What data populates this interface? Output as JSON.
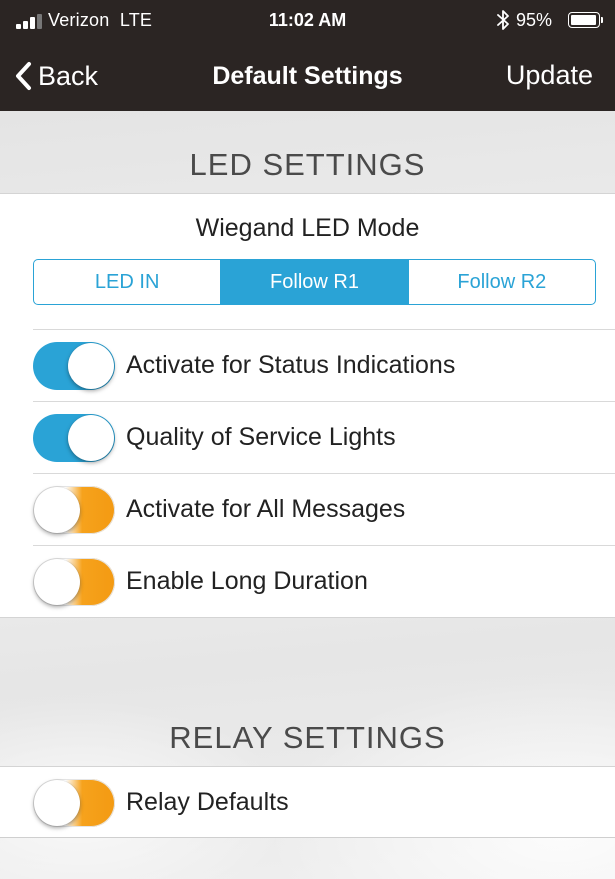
{
  "status_bar": {
    "carrier": "Verizon",
    "network": "LTE",
    "time": "11:02 AM",
    "battery_percent": "95%",
    "battery_level": 0.95,
    "signal_bars": 3,
    "icons": [
      "signal-bars-icon",
      "bluetooth-icon",
      "battery-icon"
    ]
  },
  "nav": {
    "back_label": "Back",
    "title": "Default Settings",
    "update_label": "Update"
  },
  "led_section": {
    "header": "LED SETTINGS",
    "mode_label": "Wiegand LED Mode",
    "mode_options": [
      "LED IN",
      "Follow R1",
      "Follow R2"
    ],
    "mode_selected": "Follow R1",
    "toggles": [
      {
        "label": "Activate for Status Indications",
        "state": "on"
      },
      {
        "label": "Quality of Service Lights",
        "state": "on"
      },
      {
        "label": "Activate for All Messages",
        "state": "off"
      },
      {
        "label": "Enable Long Duration",
        "state": "off"
      }
    ]
  },
  "relay_section": {
    "header": "RELAY SETTINGS",
    "toggles": [
      {
        "label": "Relay Defaults",
        "state": "off"
      }
    ]
  },
  "colors": {
    "nav_background": "#2b2523",
    "accent_blue": "#2aa3d6",
    "toggle_off_orange": "#f39a12",
    "panel_background": "#ffffff",
    "page_background": "#ececec"
  }
}
